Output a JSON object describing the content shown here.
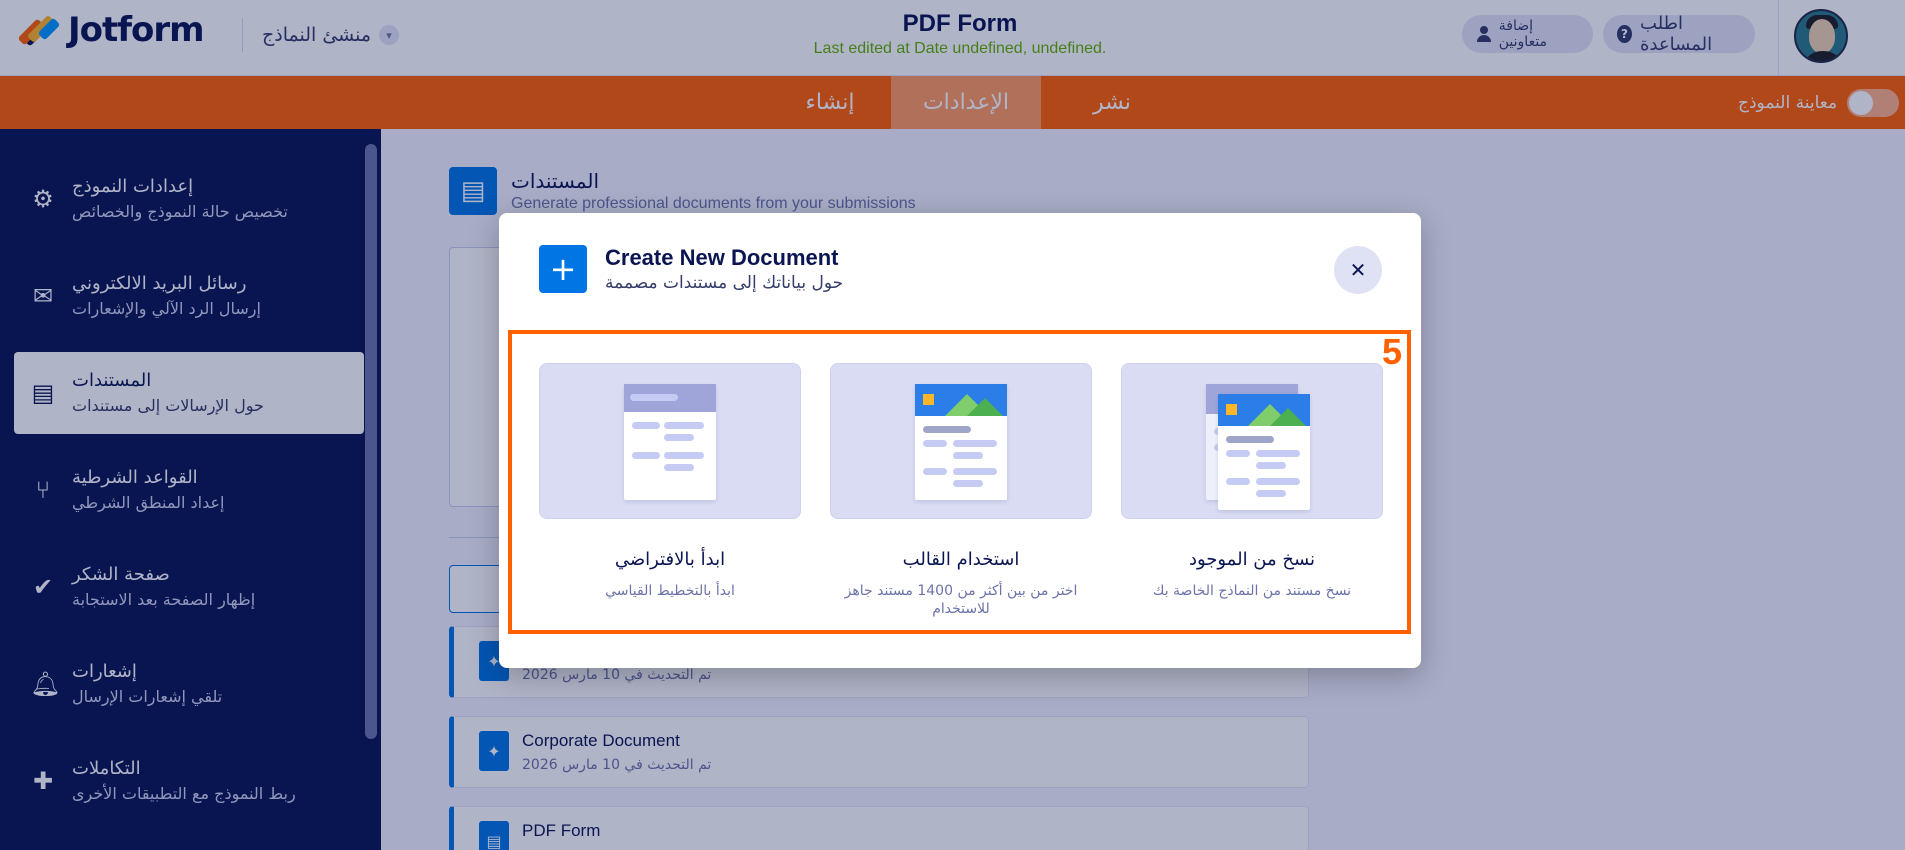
{
  "header": {
    "logo_text": "Jotform",
    "builder_label": "منشئ النماذج",
    "form_title": "PDF Form",
    "last_edited": "Last edited at Date undefined, undefined.",
    "help_label": "اطلب المساعدة",
    "collab_label": "إضافة متعاونين"
  },
  "nav": {
    "publish": "نشر",
    "settings": "الإعدادات",
    "build": "إنشاء",
    "preview_label": "معاينة النموذج"
  },
  "sidebar": {
    "items": [
      {
        "title": "إعدادات النموذج",
        "subtitle": "تخصيص حالة النموذج والخصائص",
        "icon": "gear-icon"
      },
      {
        "title": "رسائل البريد الالكتروني",
        "subtitle": "إرسال الرد الآلي والإشعارات",
        "icon": "envelope-icon"
      },
      {
        "title": "المستندات",
        "subtitle": "حول الإرسالات إلى مستندات",
        "icon": "document-icon"
      },
      {
        "title": "القواعد الشرطية",
        "subtitle": "إعداد المنطق الشرطي",
        "icon": "flow-icon"
      },
      {
        "title": "صفحة الشكر",
        "subtitle": "إظهار الصفحة بعد الاستجابة",
        "icon": "check-circle-icon"
      },
      {
        "title": "إشعارات",
        "subtitle": "تلقي إشعارات الإرسال",
        "icon": "bell-icon"
      },
      {
        "title": "التكاملات",
        "subtitle": "ربط النموذج مع التطبيقات الأخرى",
        "icon": "puzzle-icon"
      }
    ]
  },
  "main": {
    "section_title": "المستندات",
    "section_subtitle": "Generate professional documents from your submissions",
    "documents": [
      {
        "name": "",
        "date": "تم التحديث في 10 مارس 2026"
      },
      {
        "name": "Corporate Document",
        "date": "تم التحديث في 10 مارس 2026"
      },
      {
        "name": "PDF Form",
        "date": ""
      }
    ]
  },
  "modal": {
    "title": "Create New Document",
    "subtitle": "حول بياناتك إلى مستندات مصممة",
    "close_symbol": "✕",
    "step_number": "5",
    "options": [
      {
        "title": "نسخ من الموجود",
        "desc": "نسخ مستند من النماذج الخاصة بك"
      },
      {
        "title": "استخدام القالب",
        "desc": "اختر من بين أكثر من 1400 مستند جاهز للاستخدام"
      },
      {
        "title": "ابدأ بالافتراضي",
        "desc": "ابدأ بالتخطيط القياسي"
      }
    ]
  },
  "colors": {
    "brand_orange": "#ff6100",
    "navy": "#0a1551",
    "primary_blue": "#0075e3",
    "success_green": "#64b200"
  }
}
